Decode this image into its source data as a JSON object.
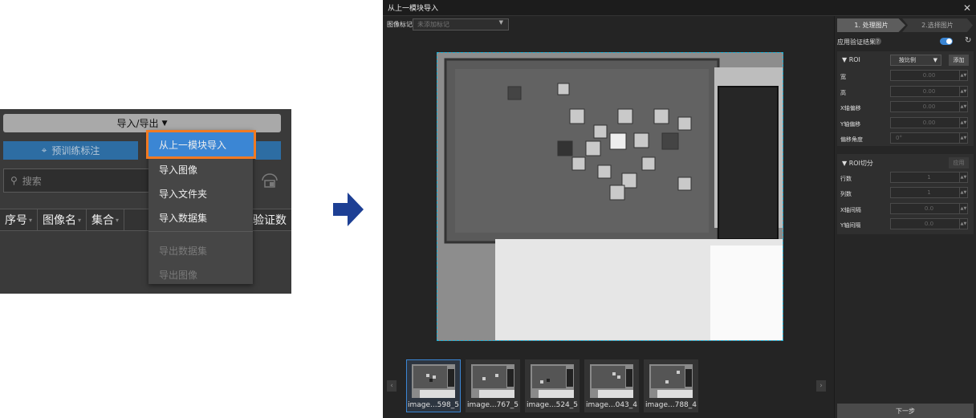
{
  "left_panel": {
    "import_export_label": "导入/导出",
    "predict_label": "预训练标注",
    "search_placeholder": "搜索",
    "columns": [
      "序号",
      "图像名",
      "集合",
      "验证数"
    ],
    "menu": [
      "从上一模块导入",
      "导入图像",
      "导入文件夹",
      "导入数据集",
      "导出数据集",
      "导出图像"
    ],
    "menu_enabled": [
      true,
      true,
      true,
      true,
      false,
      false
    ]
  },
  "dialog": {
    "title": "从上一模块导入",
    "image_tag_label": "图像标记",
    "image_tag_placeholder": "未添加标记",
    "thumbnails": [
      "image...598_5",
      "image...767_5",
      "image...524_5",
      "image...043_4",
      "image...788_4"
    ],
    "selected_thumbnail": 0
  },
  "right_panel": {
    "steps": [
      "1. 处理图片",
      "2.选择图片"
    ],
    "apply_validation_label": "应用验证结果",
    "apply_validation_on": true,
    "roi": {
      "header": "ROI",
      "mode": "按比例",
      "add_label": "添加",
      "fields": [
        {
          "label": "宽",
          "value": "0.00"
        },
        {
          "label": "高",
          "value": "0.00"
        },
        {
          "label": "X轴偏移",
          "value": "0.00"
        },
        {
          "label": "Y轴偏移",
          "value": "0.00"
        },
        {
          "label": "偏移角度",
          "value": "0°"
        }
      ]
    },
    "roi_cut": {
      "header": "ROI切分",
      "apply_label": "应用",
      "fields": [
        {
          "label": "行数",
          "value": "1"
        },
        {
          "label": "列数",
          "value": "1"
        },
        {
          "label": "X轴间隔",
          "value": "0.0"
        },
        {
          "label": "Y轴间隔",
          "value": "0.0"
        }
      ]
    },
    "next_label": "下一步"
  },
  "colors": {
    "accent": "#3b86d4",
    "highlight": "#f07a22",
    "arrow": "#1d3f94",
    "roi_border": "#1fb4d8"
  }
}
